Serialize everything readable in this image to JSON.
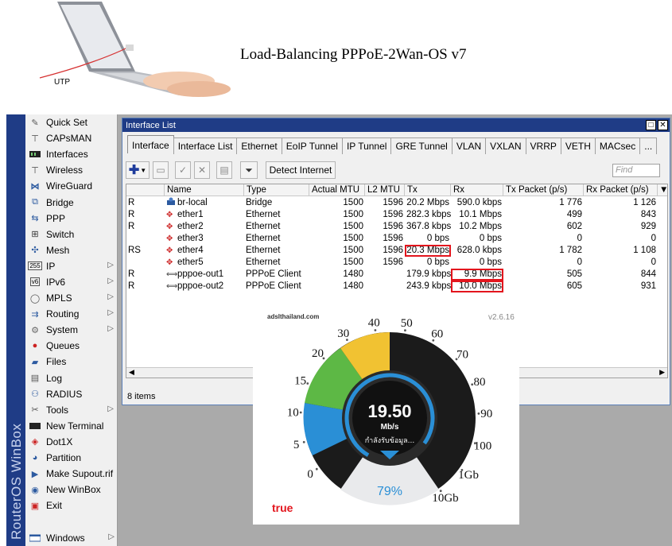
{
  "header": {
    "title": "Load-Balancing PPPoE-2Wan-OS v7",
    "cable_label": "UTP"
  },
  "brand": "RouterOS WinBox",
  "sidebar": {
    "items": [
      {
        "label": "Quick Set",
        "icon": "wand-icon",
        "submenu": false
      },
      {
        "label": "CAPsMAN",
        "icon": "antenna-icon",
        "submenu": false
      },
      {
        "label": "Interfaces",
        "icon": "interfaces-icon",
        "submenu": false
      },
      {
        "label": "Wireless",
        "icon": "wireless-icon",
        "submenu": false
      },
      {
        "label": "WireGuard",
        "icon": "wireguard-icon",
        "submenu": false
      },
      {
        "label": "Bridge",
        "icon": "bridge-icon",
        "submenu": false
      },
      {
        "label": "PPP",
        "icon": "ppp-icon",
        "submenu": false
      },
      {
        "label": "Switch",
        "icon": "switch-icon",
        "submenu": false
      },
      {
        "label": "Mesh",
        "icon": "mesh-icon",
        "submenu": false
      },
      {
        "label": "IP",
        "icon": "ip-icon",
        "submenu": true
      },
      {
        "label": "IPv6",
        "icon": "ipv6-icon",
        "submenu": true
      },
      {
        "label": "MPLS",
        "icon": "mpls-icon",
        "submenu": true
      },
      {
        "label": "Routing",
        "icon": "routing-icon",
        "submenu": true
      },
      {
        "label": "System",
        "icon": "gear-icon",
        "submenu": true
      },
      {
        "label": "Queues",
        "icon": "queues-icon",
        "submenu": false
      },
      {
        "label": "Files",
        "icon": "folder-icon",
        "submenu": false
      },
      {
        "label": "Log",
        "icon": "log-icon",
        "submenu": false
      },
      {
        "label": "RADIUS",
        "icon": "radius-icon",
        "submenu": false
      },
      {
        "label": "Tools",
        "icon": "tools-icon",
        "submenu": true
      },
      {
        "label": "New Terminal",
        "icon": "terminal-icon",
        "submenu": false
      },
      {
        "label": "Dot1X",
        "icon": "dot1x-icon",
        "submenu": false
      },
      {
        "label": "Partition",
        "icon": "partition-icon",
        "submenu": false
      },
      {
        "label": "Make Supout.rif",
        "icon": "supout-icon",
        "submenu": false
      },
      {
        "label": "New WinBox",
        "icon": "winbox-icon",
        "submenu": false
      },
      {
        "label": "Exit",
        "icon": "exit-icon",
        "submenu": false
      }
    ],
    "bottom": {
      "label": "Windows",
      "icon": "windows-icon",
      "submenu": true
    }
  },
  "window": {
    "title": "Interface List",
    "tabs": [
      "Interface",
      "Interface List",
      "Ethernet",
      "EoIP Tunnel",
      "IP Tunnel",
      "GRE Tunnel",
      "VLAN",
      "VXLAN",
      "VRRP",
      "VETH",
      "MACsec",
      "..."
    ],
    "active_tab": 0,
    "detect_internet_label": "Detect Internet",
    "find_placeholder": "Find",
    "columns": [
      "Name",
      "Type",
      "Actual MTU",
      "L2 MTU",
      "Tx",
      "Rx",
      "Tx Packet (p/s)",
      "Rx Packet (p/s)"
    ],
    "rows": [
      {
        "flag": "R",
        "name": "br-local",
        "type": "Bridge",
        "mtu": "1500",
        "l2mtu": "1596",
        "tx": "20.2 Mbps",
        "rx": "590.0 kbps",
        "txp": "1 776",
        "rxp": "1 126",
        "icon": "bridge-icon"
      },
      {
        "flag": "R",
        "name": "ether1",
        "type": "Ethernet",
        "mtu": "1500",
        "l2mtu": "1596",
        "tx": "282.3 kbps",
        "rx": "10.1 Mbps",
        "txp": "499",
        "rxp": "843",
        "icon": "ethernet-icon"
      },
      {
        "flag": "R",
        "name": "ether2",
        "type": "Ethernet",
        "mtu": "1500",
        "l2mtu": "1596",
        "tx": "367.8 kbps",
        "rx": "10.2 Mbps",
        "txp": "602",
        "rxp": "929",
        "icon": "ethernet-icon"
      },
      {
        "flag": "",
        "name": "ether3",
        "type": "Ethernet",
        "mtu": "1500",
        "l2mtu": "1596",
        "tx": "0 bps",
        "rx": "0 bps",
        "txp": "0",
        "rxp": "0",
        "icon": "ethernet-icon"
      },
      {
        "flag": "RS",
        "name": "ether4",
        "type": "Ethernet",
        "mtu": "1500",
        "l2mtu": "1596",
        "tx": "20.3 Mbps",
        "rx": "628.0 kbps",
        "txp": "1 782",
        "rxp": "1 108",
        "icon": "ethernet-icon"
      },
      {
        "flag": "",
        "name": "ether5",
        "type": "Ethernet",
        "mtu": "1500",
        "l2mtu": "1596",
        "tx": "0 bps",
        "rx": "0 bps",
        "txp": "0",
        "rxp": "0",
        "icon": "ethernet-icon"
      },
      {
        "flag": "R",
        "name": "pppoe-out1",
        "type": "PPPoE Client",
        "mtu": "1480",
        "l2mtu": "",
        "tx": "179.9 kbps",
        "rx": "9.9 Mbps",
        "txp": "505",
        "rxp": "844",
        "icon": "pppoe-icon"
      },
      {
        "flag": "R",
        "name": "pppoe-out2",
        "type": "PPPoE Client",
        "mtu": "1480",
        "l2mtu": "",
        "tx": "243.9 kbps",
        "rx": "10.0 Mbps",
        "txp": "605",
        "rxp": "931",
        "icon": "pppoe-icon"
      }
    ],
    "status": "8 items"
  },
  "speedtest": {
    "site": "adslthailand.com",
    "version": "v2.6.16",
    "value": "19.50",
    "unit": "Mb/s",
    "status": "กำลังรับข้อมูล...",
    "percent": "79%",
    "brand": "true",
    "scale": [
      "0",
      "5",
      "10",
      "15",
      "20",
      "30",
      "40",
      "50",
      "60",
      "70",
      "80",
      "90",
      "100",
      "1Gb",
      "10Gb"
    ],
    "colors": {
      "dark": "#222222",
      "gauge_blue": "#2a8fd6",
      "gauge_green": "#5db845",
      "gauge_yellow": "#f1c232",
      "brand_red": "#e3151d"
    }
  }
}
